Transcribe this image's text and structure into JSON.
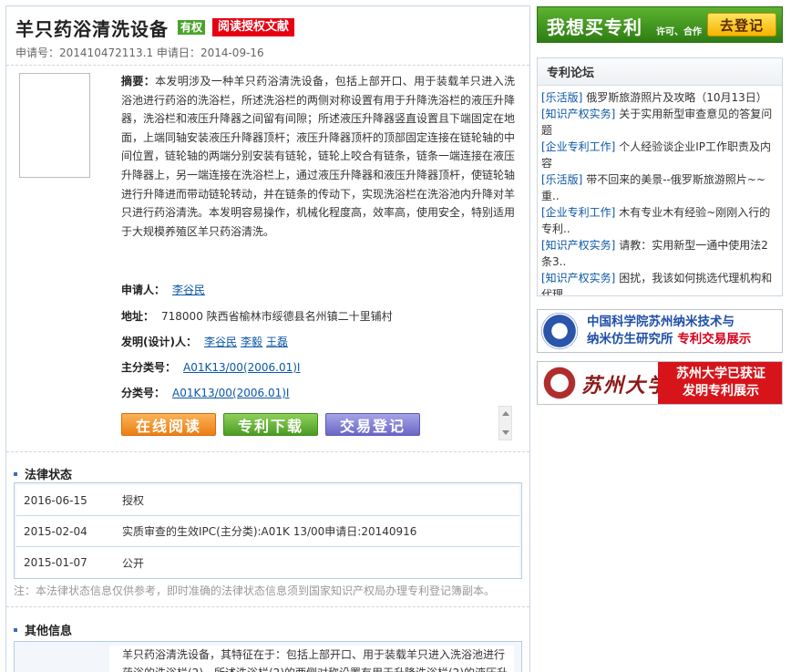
{
  "patent": {
    "title": "羊只药浴清洗设备",
    "status_badge": "有权",
    "read_badge": "阅读授权文献",
    "app_no_label": "申请号：",
    "app_no": "201410472113.1",
    "app_date_label": "申请日：",
    "app_date": "2014-09-16",
    "abstract_label": "摘要：",
    "abstract": "本发明涉及一种羊只药浴清洗设备，包括上部开口、用于装载羊只进入洗浴池进行药浴的洗浴栏，所述洗浴栏的两侧对称设置有用于升降洗浴栏的液压升降器，洗浴栏和液压升降器之间留有间隙；所述液压升降器竖直设置且下端固定在地面，上端同轴安装液压升降器顶杆；液压升降器顶杆的顶部固定连接在链轮轴的中间位置，链轮轴的两端分别安装有链轮，链轮上咬合有链条，链条一端连接在液压升降器上，另一端连接在洗浴栏上，通过液压升降器和液压升降器顶杆，使链轮轴进行升降进而带动链轮转动，并在链条的传动下，实现洗浴栏在洗浴池内升降对羊只进行药浴清洗。本发明容易操作，机械化程度高，效率高，使用安全，特别适用于大规模养殖区羊只药浴清洗。",
    "applicant_label": "申请人：",
    "applicant": "李谷民",
    "address_label": "地址：",
    "address": "718000 陕西省榆林市绥德县名州镇二十里铺村",
    "inventor_label": "发明(设计)人：",
    "inventors": [
      "李谷民",
      "李毅",
      "王磊"
    ],
    "main_class_label": "主分类号：",
    "main_class": "A01K13/00(2006.01)I",
    "class_label": "分类号：",
    "class": "A01K13/00(2006.01)I"
  },
  "actions": {
    "read_online": "在线阅读",
    "download": "专利下载",
    "trade_register": "交易登记"
  },
  "legal_status": {
    "section_title": "法律状态",
    "rows": [
      {
        "date": "2016-06-15",
        "text": "授权"
      },
      {
        "date": "2015-02-04",
        "text": "实质审查的生效IPC(主分类):A01K 13/00申请日:20140916"
      },
      {
        "date": "2015-01-07",
        "text": "公开"
      }
    ],
    "note": "注：本法律状态信息仅供参考，即时准确的法律状态信息须到国家知识产权局办理专利登记簿副本。"
  },
  "other_info": {
    "section_title": "其他信息",
    "text": "羊只药浴清洗设备，其特征在于：包括上部开口、用于装载羊只进入洗浴池进行药浴的洗浴栏(2)，所述洗浴栏(2)的两侧对称设置有用于升降洗浴栏(2)的液压升"
  },
  "sidebar": {
    "buy_main": "我想买专利",
    "buy_sub": "许可、合作",
    "buy_button": "去登记",
    "forum_title": "专利论坛",
    "forum_items": [
      {
        "cat": "[乐活版]",
        "text": "俄罗斯旅游照片及攻略（10月13日）"
      },
      {
        "cat": "[知识产权实务]",
        "text": "关于实用新型审查意见的答复问题"
      },
      {
        "cat": "[企业专利工作]",
        "text": "个人经验谈企业IP工作职责及内容"
      },
      {
        "cat": "[乐活版]",
        "text": "带不回来的美景--俄罗斯旅游照片~~重.."
      },
      {
        "cat": "[企业专利工作]",
        "text": "木有专业木有经验~刚刚入行的专利.."
      },
      {
        "cat": "[知识产权实务]",
        "text": "请教：实用新型一通中使用法2条3.."
      },
      {
        "cat": "[知识产权实务]",
        "text": "困扰，我该如何挑选代理机构和代理"
      }
    ],
    "cas_line1": "中国科学院苏州纳米技术与",
    "cas_line2": "纳米仿生研究所",
    "cas_line2_hl": "专利交易展示",
    "suda_name": "苏州大学",
    "suda_line1": "苏州大学已获证",
    "suda_line2": "发明专利展示"
  }
}
